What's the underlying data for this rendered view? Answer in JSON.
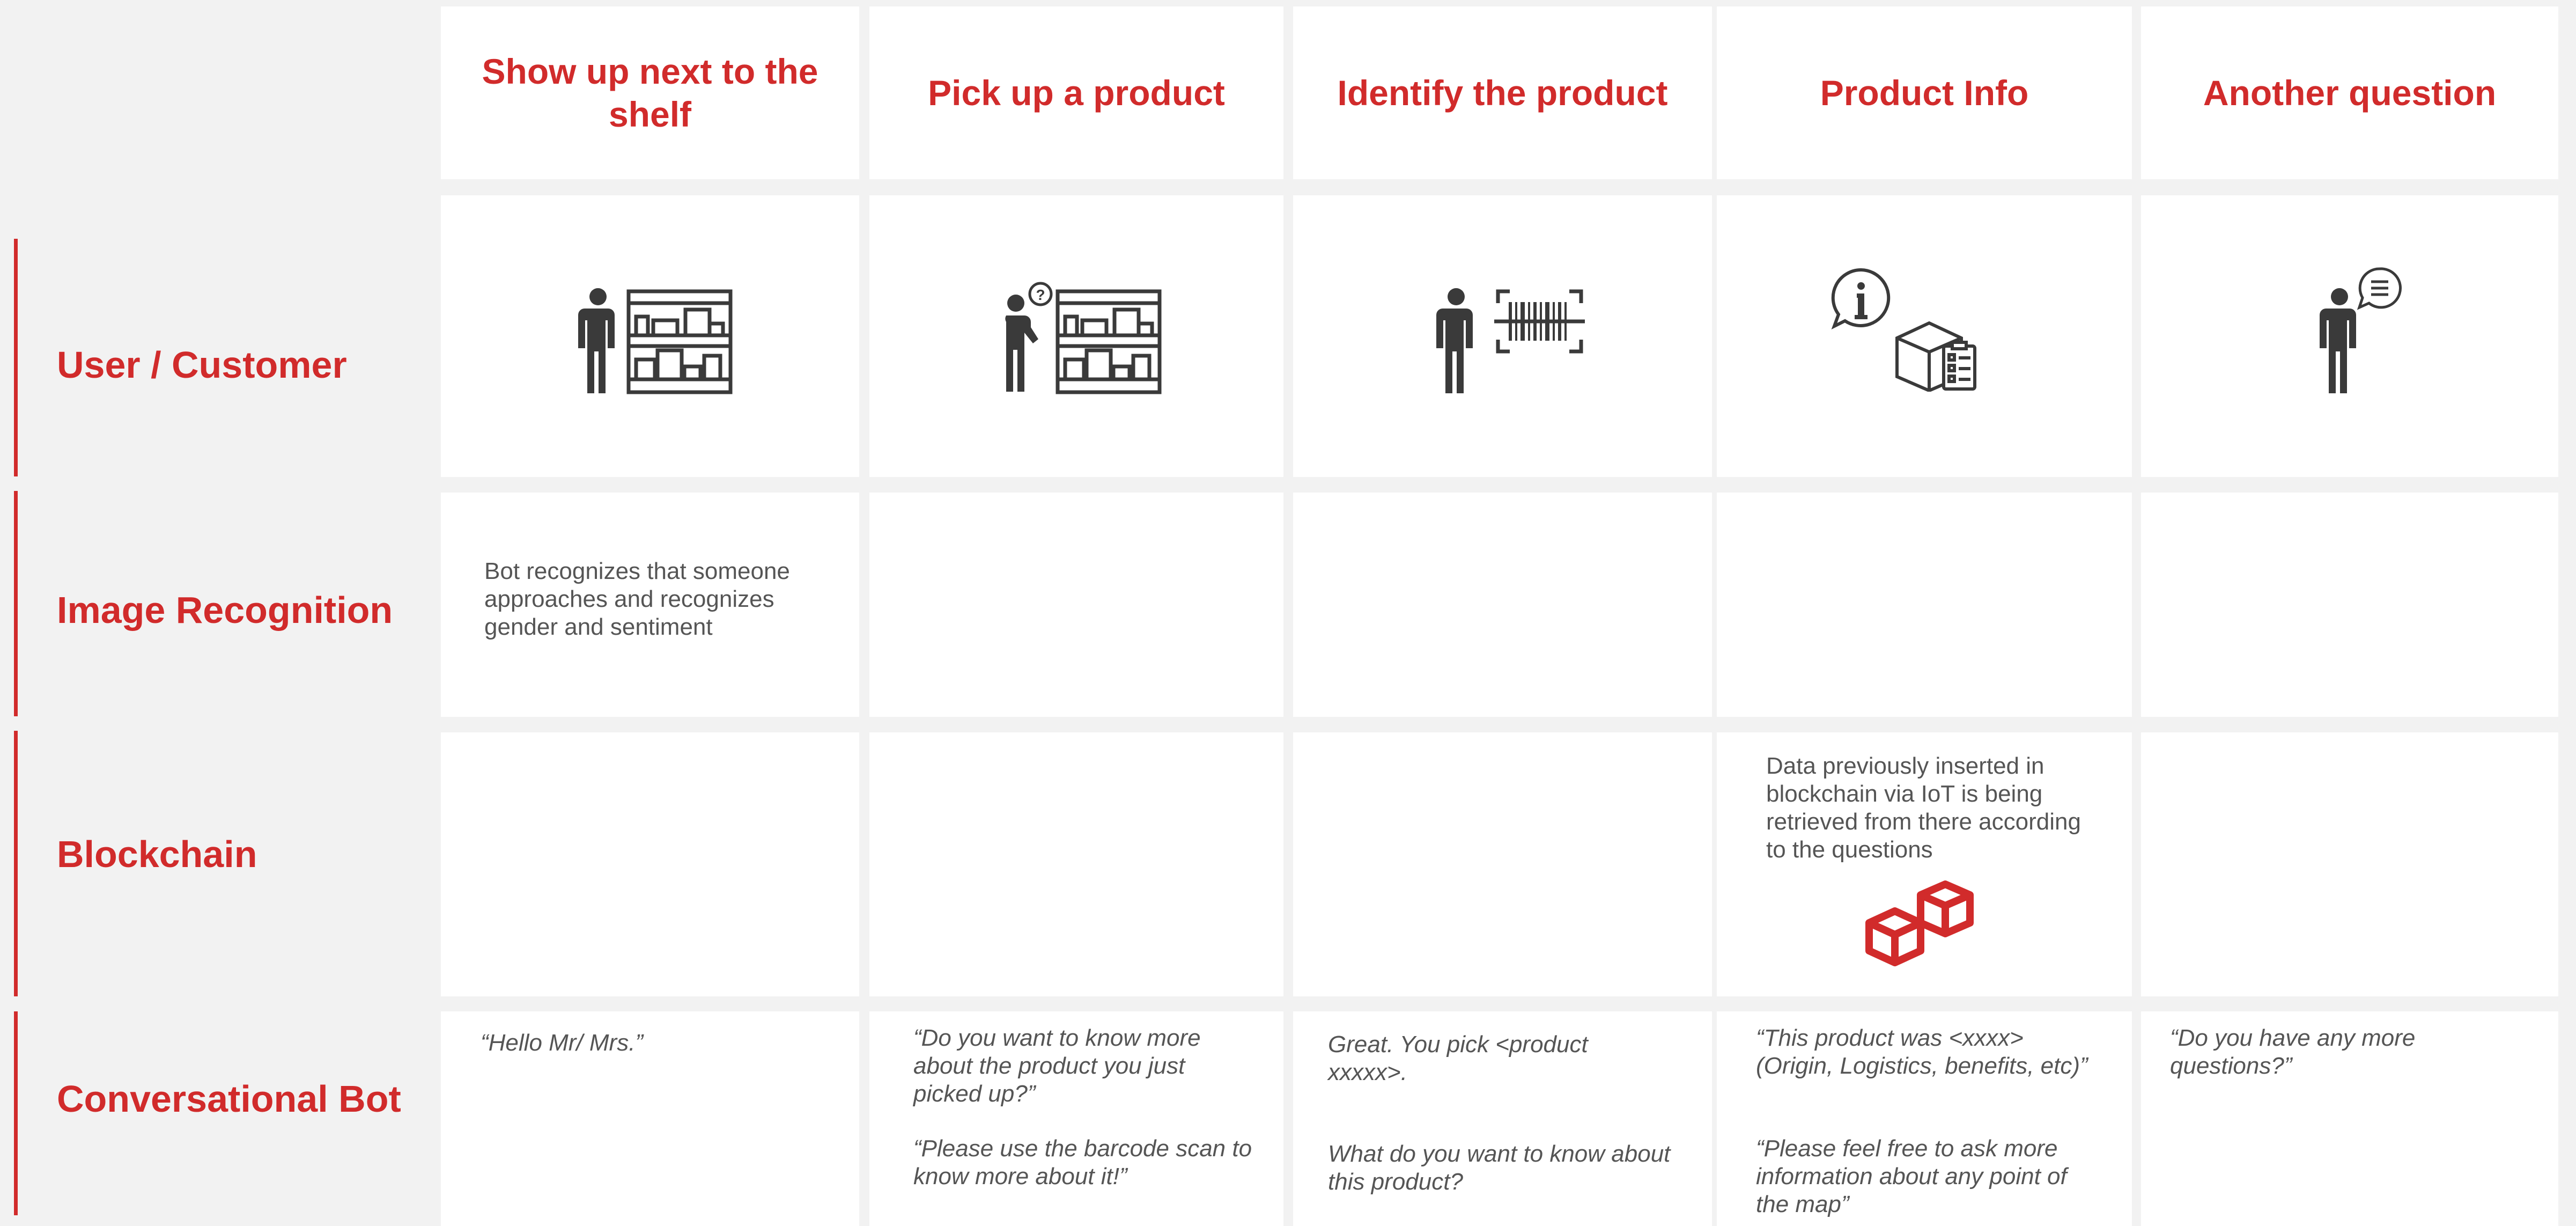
{
  "columns": [
    "Show up next to the shelf",
    "Pick up a product",
    "Identify the product",
    "Product Info",
    "Another question"
  ],
  "rows": [
    "User / Customer",
    "Image Recognition",
    "Blockchain",
    "Conversational Bot"
  ],
  "image_recognition": {
    "col1": "Bot recognizes that someone approaches and recognizes gender and sentiment"
  },
  "blockchain": {
    "col4": "Data previously inserted in blockchain via IoT is being retrieved from there according to the questions"
  },
  "bot": {
    "col1": "“Hello Mr/ Mrs.”",
    "col2_a": "“Do you want to know more about the product you just picked up?”",
    "col2_b": "“Please use the barcode scan to know more about it!”",
    "col3_a": "Great. You pick <product xxxxx>.",
    "col3_b": "What do you want to know about this product?",
    "col4_a": "“This product was <xxxx> (Origin, Logistics, benefits, etc)”",
    "col4_b": "“Please feel free to ask more information about any point of the map”",
    "col5": "“Do you have any more questions?”"
  },
  "icons": {
    "col1": "person-at-shelf-icon",
    "col2": "person-thinking-at-shelf-icon",
    "col3": "person-barcode-scan-icon",
    "col4": "info-box-checklist-icon",
    "col5": "person-speech-bubble-icon",
    "blockchain": "blockchain-cubes-icon"
  },
  "colors": {
    "accent": "#d12b2b",
    "icon": "#3a3a3a",
    "background": "#f2f2f2"
  }
}
